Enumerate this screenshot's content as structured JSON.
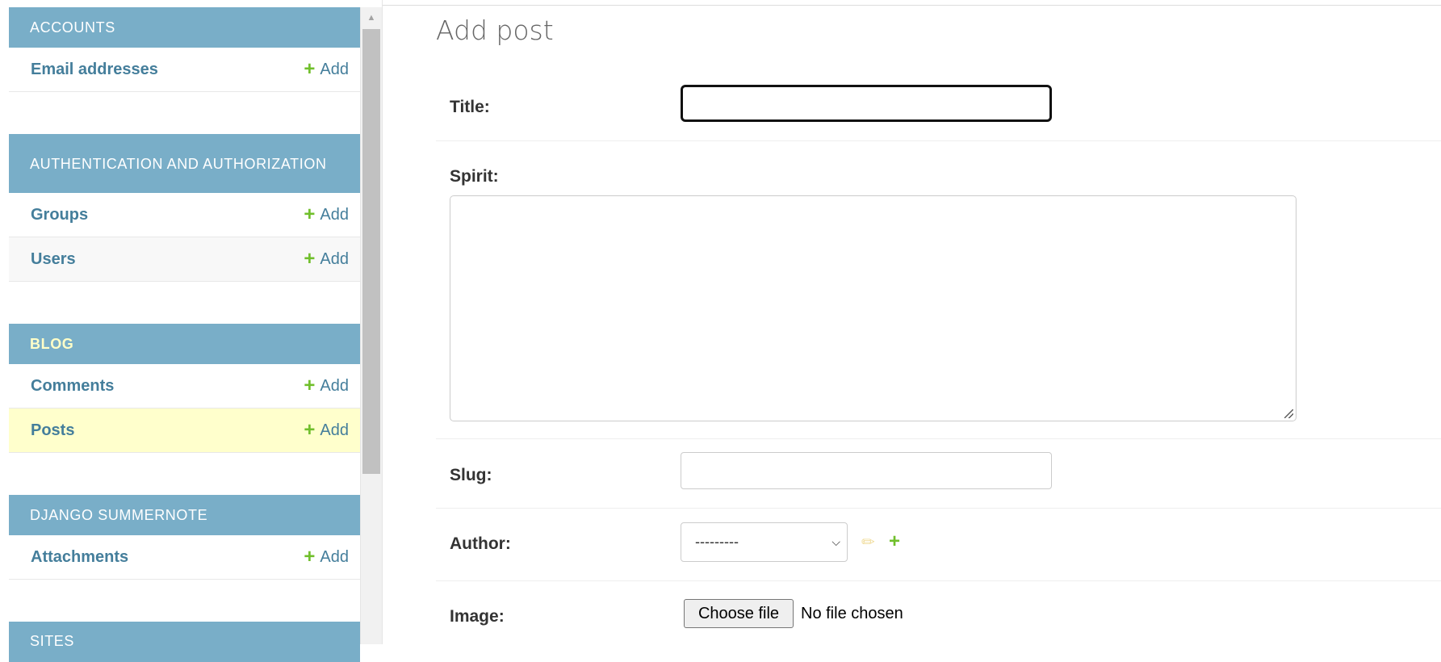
{
  "sidebar": {
    "sections": [
      {
        "caption": "Accounts",
        "models": [
          {
            "name": "Email addresses",
            "add": "Add"
          }
        ]
      },
      {
        "caption": "Authentication and Authorization",
        "models": [
          {
            "name": "Groups",
            "add": "Add"
          },
          {
            "name": "Users",
            "add": "Add"
          }
        ]
      },
      {
        "caption": "Blog",
        "models": [
          {
            "name": "Comments",
            "add": "Add"
          },
          {
            "name": "Posts",
            "add": "Add"
          }
        ]
      },
      {
        "caption": "Django Summernote",
        "models": [
          {
            "name": "Attachments",
            "add": "Add"
          }
        ]
      },
      {
        "caption": "Sites",
        "models": []
      }
    ]
  },
  "main": {
    "title": "Add post",
    "fields": {
      "title": {
        "label": "Title:",
        "value": ""
      },
      "spirit": {
        "label": "Spirit:",
        "value": ""
      },
      "slug": {
        "label": "Slug:",
        "value": ""
      },
      "author": {
        "label": "Author:",
        "selected": "---------"
      },
      "image": {
        "label": "Image:",
        "button": "Choose file",
        "status": "No file chosen"
      }
    }
  },
  "colors": {
    "caption_bg": "#79aec8",
    "link": "#447e9b",
    "add_plus": "#70bf2b",
    "current_row": "#ffffcc"
  },
  "icons": {
    "add": "plus-icon",
    "change": "pencil-icon",
    "select": "chevron-down-icon"
  }
}
